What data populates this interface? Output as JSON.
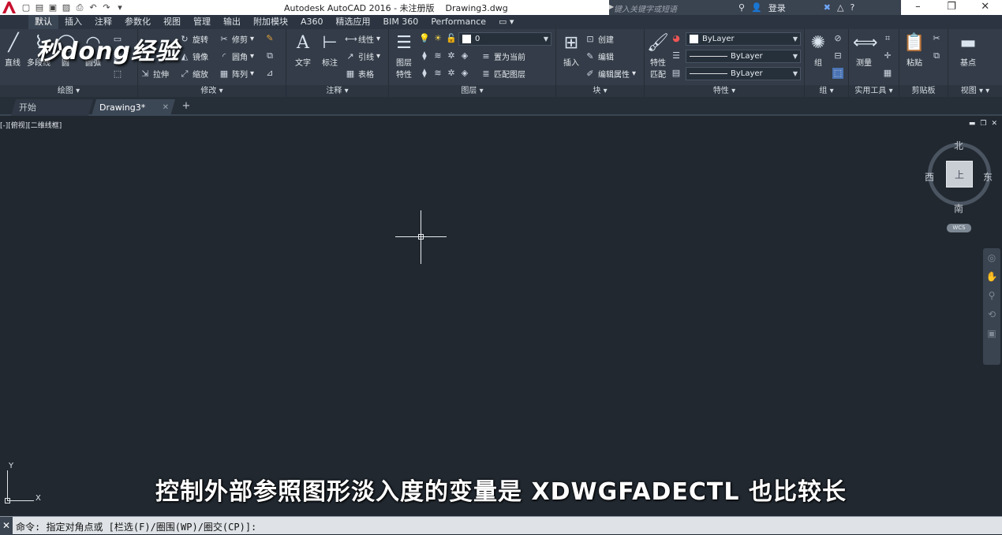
{
  "titlebar": {
    "title": "Autodesk AutoCAD 2016 - 未注册版    Drawing3.dwg",
    "search_placeholder": "键入关键字或短语",
    "login_label": "登录",
    "quick_access_icons": [
      "new-icon",
      "open-icon",
      "save-icon",
      "saveas-icon",
      "plot-icon",
      "undo-icon",
      "redo-icon"
    ]
  },
  "ribbon_tabs": [
    "默认",
    "插入",
    "注释",
    "参数化",
    "视图",
    "管理",
    "输出",
    "附加模块",
    "A360",
    "精选应用",
    "BIM 360",
    "Performance"
  ],
  "ribbon": {
    "draw": {
      "title": "绘图",
      "line": "直线",
      "polyline": "多段线",
      "circle": "圆",
      "arc": "圆弧"
    },
    "modify": {
      "title": "修改",
      "rotate": "旋转",
      "trim": "修剪",
      "mirror": "镜像",
      "fillet": "圆角",
      "stretch": "拉伸",
      "scale": "缩放",
      "array": "阵列"
    },
    "annotation": {
      "title": "注释",
      "text": "文字",
      "dimension": "标注",
      "linear": "线性",
      "leader": "引线",
      "table": "表格"
    },
    "layers": {
      "title": "图层",
      "layer_properties_line1": "图层",
      "layer_properties_line2": "特性",
      "current_layer": "0",
      "set_current": "置为当前",
      "match_layer": "匹配图层"
    },
    "block": {
      "title": "块",
      "insert": "插入",
      "create": "创建",
      "edit": "编辑",
      "edit_attributes": "编辑属性"
    },
    "properties": {
      "title": "特性",
      "match_line1": "特性",
      "match_line2": "匹配",
      "color": "ByLayer",
      "linetype": "ByLayer",
      "lineweight": "ByLayer"
    },
    "groups": {
      "title": "组",
      "group": "组"
    },
    "utilities": {
      "title": "实用工具",
      "measure": "测量"
    },
    "clipboard": {
      "title": "剪贴板",
      "paste": "粘贴"
    },
    "view": {
      "title": "视图",
      "base": "基点"
    }
  },
  "file_tabs": [
    {
      "label": "开始"
    },
    {
      "label": "Drawing3*"
    }
  ],
  "viewport": {
    "label": "[-][俯视][二维线框]"
  },
  "viewcube": {
    "north": "北",
    "south": "南",
    "east": "东",
    "west": "西",
    "face": "上",
    "wcs": "WCS"
  },
  "ucs": {
    "x": "X",
    "y": "Y"
  },
  "subtitle": "控制外部参照图形淡入度的变量是 XDWGFADECTL 也比较长",
  "watermark": "秒dong经验",
  "command_line": "命令: 指定对角点或 [栏选(F)/圈围(WP)/圈交(CP)]:",
  "colors": {
    "canvas": "#212830",
    "ribbon": "#333c48",
    "accent_red": "#c8102e"
  }
}
